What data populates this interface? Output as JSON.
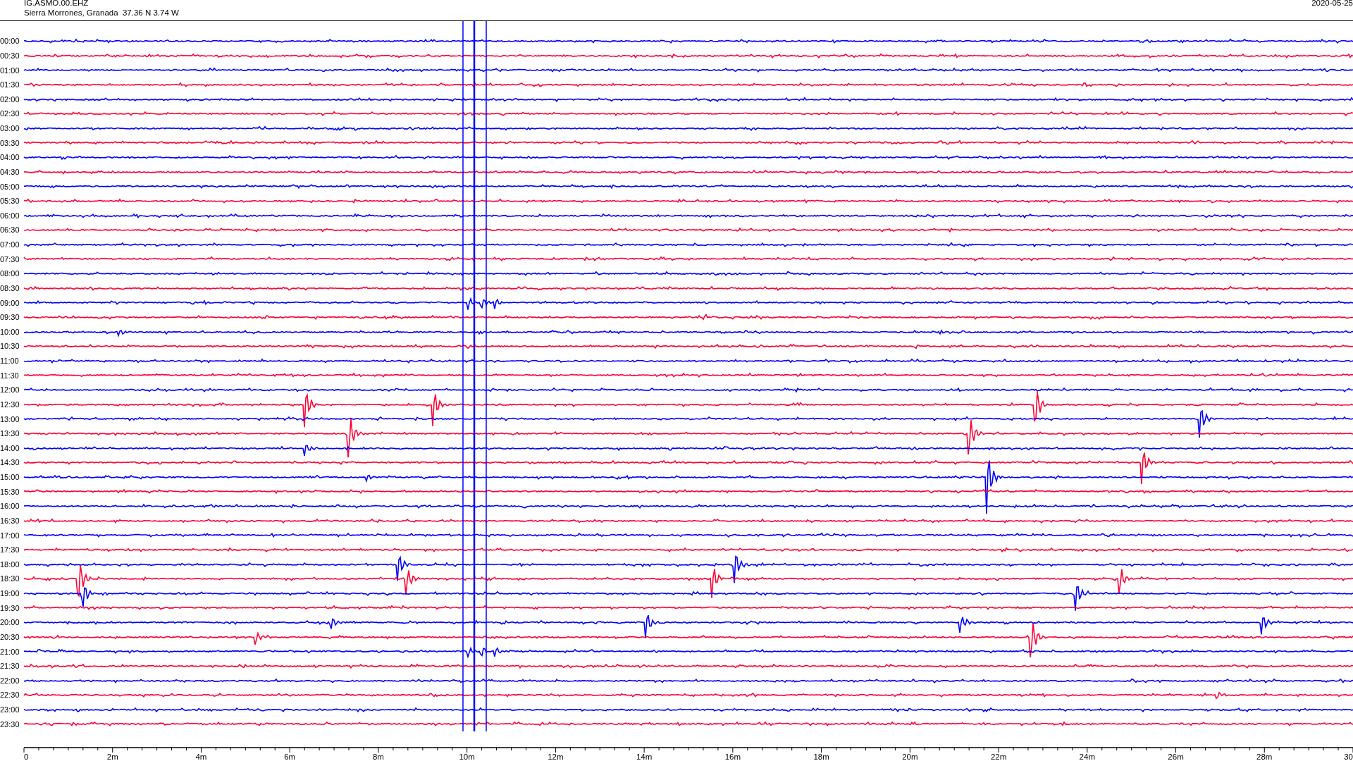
{
  "header": {
    "station": "IG.ASMO.00.EHZ",
    "location": "Sierra Morrones, Granada  37.36 N 3.74 W",
    "date": "2020-05-25"
  },
  "rows": [
    {
      "time": "00:00",
      "color": "#0000ff"
    },
    {
      "time": "00:30",
      "color": "#ff0033"
    },
    {
      "time": "01:00",
      "color": "#0000ff"
    },
    {
      "time": "01:30",
      "color": "#ff0033"
    },
    {
      "time": "02:00",
      "color": "#0000ff"
    },
    {
      "time": "02:30",
      "color": "#ff0033"
    },
    {
      "time": "03:00",
      "color": "#0000ff"
    },
    {
      "time": "03:30",
      "color": "#ff0033"
    },
    {
      "time": "04:00",
      "color": "#0000ff"
    },
    {
      "time": "04:30",
      "color": "#ff0033"
    },
    {
      "time": "05:00",
      "color": "#0000ff"
    },
    {
      "time": "05:30",
      "color": "#ff0033"
    },
    {
      "time": "06:00",
      "color": "#0000ff"
    },
    {
      "time": "06:30",
      "color": "#ff0033"
    },
    {
      "time": "07:00",
      "color": "#0000ff"
    },
    {
      "time": "07:30",
      "color": "#ff0033"
    },
    {
      "time": "08:00",
      "color": "#0000ff"
    },
    {
      "time": "08:30",
      "color": "#ff0033"
    },
    {
      "time": "09:00",
      "color": "#0000ff"
    },
    {
      "time": "09:30",
      "color": "#ff0033"
    },
    {
      "time": "10:00",
      "color": "#0000ff"
    },
    {
      "time": "10:30",
      "color": "#ff0033"
    },
    {
      "time": "11:00",
      "color": "#0000ff"
    },
    {
      "time": "11:30",
      "color": "#ff0033"
    },
    {
      "time": "12:00",
      "color": "#0000ff"
    },
    {
      "time": "12:30",
      "color": "#ff0033"
    },
    {
      "time": "13:00",
      "color": "#0000ff"
    },
    {
      "time": "13:30",
      "color": "#ff0033"
    },
    {
      "time": "14:00",
      "color": "#0000ff"
    },
    {
      "time": "14:30",
      "color": "#ff0033"
    },
    {
      "time": "15:00",
      "color": "#0000ff"
    },
    {
      "time": "15:30",
      "color": "#ff0033"
    },
    {
      "time": "16:00",
      "color": "#0000ff"
    },
    {
      "time": "16:30",
      "color": "#ff0033"
    },
    {
      "time": "17:00",
      "color": "#0000ff"
    },
    {
      "time": "17:30",
      "color": "#ff0033"
    },
    {
      "time": "18:00",
      "color": "#0000ff"
    },
    {
      "time": "18:30",
      "color": "#ff0033"
    },
    {
      "time": "19:00",
      "color": "#0000ff"
    },
    {
      "time": "19:30",
      "color": "#ff0033"
    },
    {
      "time": "20:00",
      "color": "#0000ff"
    },
    {
      "time": "20:30",
      "color": "#ff0033"
    },
    {
      "time": "21:00",
      "color": "#0000ff"
    },
    {
      "time": "21:30",
      "color": "#ff0033"
    },
    {
      "time": "22:00",
      "color": "#0000ff"
    },
    {
      "time": "22:30",
      "color": "#ff0033"
    },
    {
      "time": "23:00",
      "color": "#0000ff"
    },
    {
      "time": "23:30",
      "color": "#ff0033"
    }
  ],
  "x_axis": {
    "ticks": [
      "0",
      "2m",
      "4m",
      "6m",
      "8m",
      "10m",
      "12m",
      "14m",
      "16m",
      "18m",
      "20m",
      "22m",
      "24m",
      "26m",
      "28m",
      "30"
    ]
  }
}
